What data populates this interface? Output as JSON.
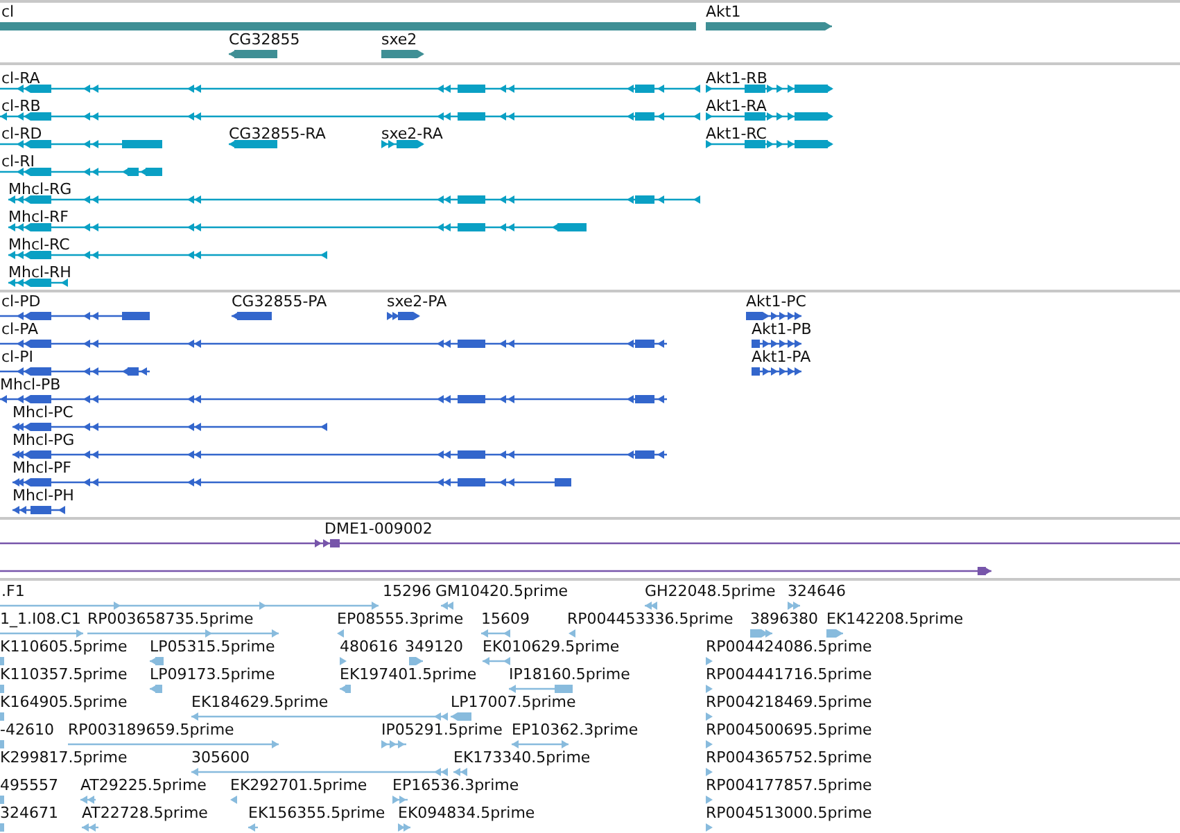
{
  "tracks": [
    {
      "kind": "genes",
      "features": [
        {
          "label": "cl"
        },
        {
          "label": "Akt1"
        },
        {
          "label": "CG32855"
        },
        {
          "label": "sxe2"
        }
      ]
    },
    {
      "kind": "transcripts",
      "features": [
        {
          "label": "cl-RA"
        },
        {
          "label": "Akt1-RB"
        },
        {
          "label": "cl-RB"
        },
        {
          "label": "Akt1-RA"
        },
        {
          "label": "cl-RD"
        },
        {
          "label": "CG32855-RA"
        },
        {
          "label": "sxe2-RA"
        },
        {
          "label": "Akt1-RC"
        },
        {
          "label": "cl-RI"
        },
        {
          "label": "Mhcl-RG"
        },
        {
          "label": "Mhcl-RF"
        },
        {
          "label": "Mhcl-RC"
        },
        {
          "label": "Mhcl-RH"
        }
      ]
    },
    {
      "kind": "proteins",
      "features": [
        {
          "label": "cl-PD"
        },
        {
          "label": "CG32855-PA"
        },
        {
          "label": "sxe2-PA"
        },
        {
          "label": "Akt1-PC"
        },
        {
          "label": "cl-PA"
        },
        {
          "label": "Akt1-PB"
        },
        {
          "label": "cl-PI"
        },
        {
          "label": "Akt1-PA"
        },
        {
          "label": "Mhcl-PB"
        },
        {
          "label": "Mhcl-PC"
        },
        {
          "label": "Mhcl-PG"
        },
        {
          "label": "Mhcl-PF"
        },
        {
          "label": "Mhcl-PH"
        }
      ]
    },
    {
      "kind": "alignments",
      "features": [
        {
          "label": "DME1-009002"
        }
      ]
    },
    {
      "kind": "ests",
      "features": [
        {
          "label": ".F1"
        },
        {
          "label": "15296"
        },
        {
          "label": "GM10420.5prime"
        },
        {
          "label": "GH22048.5prime"
        },
        {
          "label": "324646"
        },
        {
          "label": "1_1.I08.C1"
        },
        {
          "label": "RP003658735.5prime"
        },
        {
          "label": "EP08555.3prime"
        },
        {
          "label": "15609"
        },
        {
          "label": "RP004453336.5prime"
        },
        {
          "label": "3896380"
        },
        {
          "label": "EK142208.5prime"
        },
        {
          "label": "K110605.5prime"
        },
        {
          "label": "LP05315.5prime"
        },
        {
          "label": "480616"
        },
        {
          "label": "349120"
        },
        {
          "label": "EK010629.5prime"
        },
        {
          "label": "RP004424086.5prime"
        },
        {
          "label": "K110357.5prime"
        },
        {
          "label": "LP09173.5prime"
        },
        {
          "label": "EK197401.5prime"
        },
        {
          "label": "IP18160.5prime"
        },
        {
          "label": "RP004441716.5prime"
        },
        {
          "label": "K164905.5prime"
        },
        {
          "label": "EK184629.5prime"
        },
        {
          "label": "LP17007.5prime"
        },
        {
          "label": "RP004218469.5prime"
        },
        {
          "label": "-42610"
        },
        {
          "label": "RP003189659.5prime"
        },
        {
          "label": "IP05291.5prime"
        },
        {
          "label": "EP10362.3prime"
        },
        {
          "label": "RP004500695.5prime"
        },
        {
          "label": "K299817.5prime"
        },
        {
          "label": "305600"
        },
        {
          "label": "EK173340.5prime"
        },
        {
          "label": "RP004365752.5prime"
        },
        {
          "label": "495557"
        },
        {
          "label": "AT29225.5prime"
        },
        {
          "label": "EK292701.5prime"
        },
        {
          "label": "EP16536.3prime"
        },
        {
          "label": "RP004177857.5prime"
        },
        {
          "label": "324671"
        },
        {
          "label": "AT22728.5prime"
        },
        {
          "label": "EK156355.5prime"
        },
        {
          "label": "EK094834.5prime"
        },
        {
          "label": "RP004513000.5prime"
        }
      ]
    }
  ]
}
